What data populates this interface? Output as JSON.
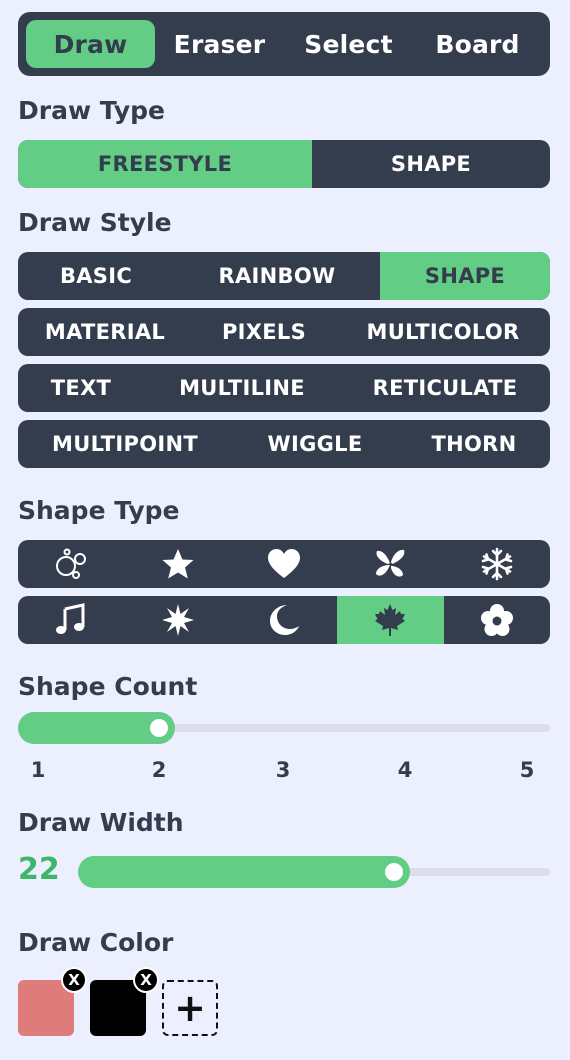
{
  "tabs": [
    {
      "label": "Draw",
      "active": true
    },
    {
      "label": "Eraser",
      "active": false
    },
    {
      "label": "Select",
      "active": false
    },
    {
      "label": "Board",
      "active": false
    }
  ],
  "draw_type": {
    "heading": "Draw Type",
    "options": [
      "FREESTYLE",
      "SHAPE"
    ],
    "selected": "FREESTYLE"
  },
  "draw_style": {
    "heading": "Draw Style",
    "rows": [
      [
        "BASIC",
        "RAINBOW",
        "SHAPE"
      ],
      [
        "MATERIAL",
        "PIXELS",
        "MULTICOLOR"
      ],
      [
        "TEXT",
        "MULTILINE",
        "RETICULATE"
      ],
      [
        "MULTIPOINT",
        "WIGGLE",
        "THORN"
      ]
    ],
    "selected": "SHAPE"
  },
  "shape_type": {
    "heading": "Shape Type",
    "rows": [
      [
        "bubbles-icon",
        "star-icon",
        "heart-icon",
        "butterfly-icon",
        "snowflake-icon"
      ],
      [
        "music-note-icon",
        "sun-burst-icon",
        "moon-icon",
        "maple-leaf-icon",
        "flower-icon"
      ]
    ],
    "selected": "maple-leaf-icon"
  },
  "shape_count": {
    "heading": "Shape Count",
    "min": 1,
    "max": 5,
    "value": 2,
    "ticks": [
      "1",
      "2",
      "3",
      "4",
      "5"
    ]
  },
  "draw_width": {
    "heading": "Draw Width",
    "value": "22",
    "fill_fraction": 0.67
  },
  "draw_color": {
    "heading": "Draw Color",
    "colors": [
      "#e07b7b",
      "#000000"
    ],
    "remove_label": "X",
    "add_label": "+"
  },
  "theme": {
    "accent": "#63cd85",
    "dark": "#333d4e",
    "background": "#eceffd"
  }
}
